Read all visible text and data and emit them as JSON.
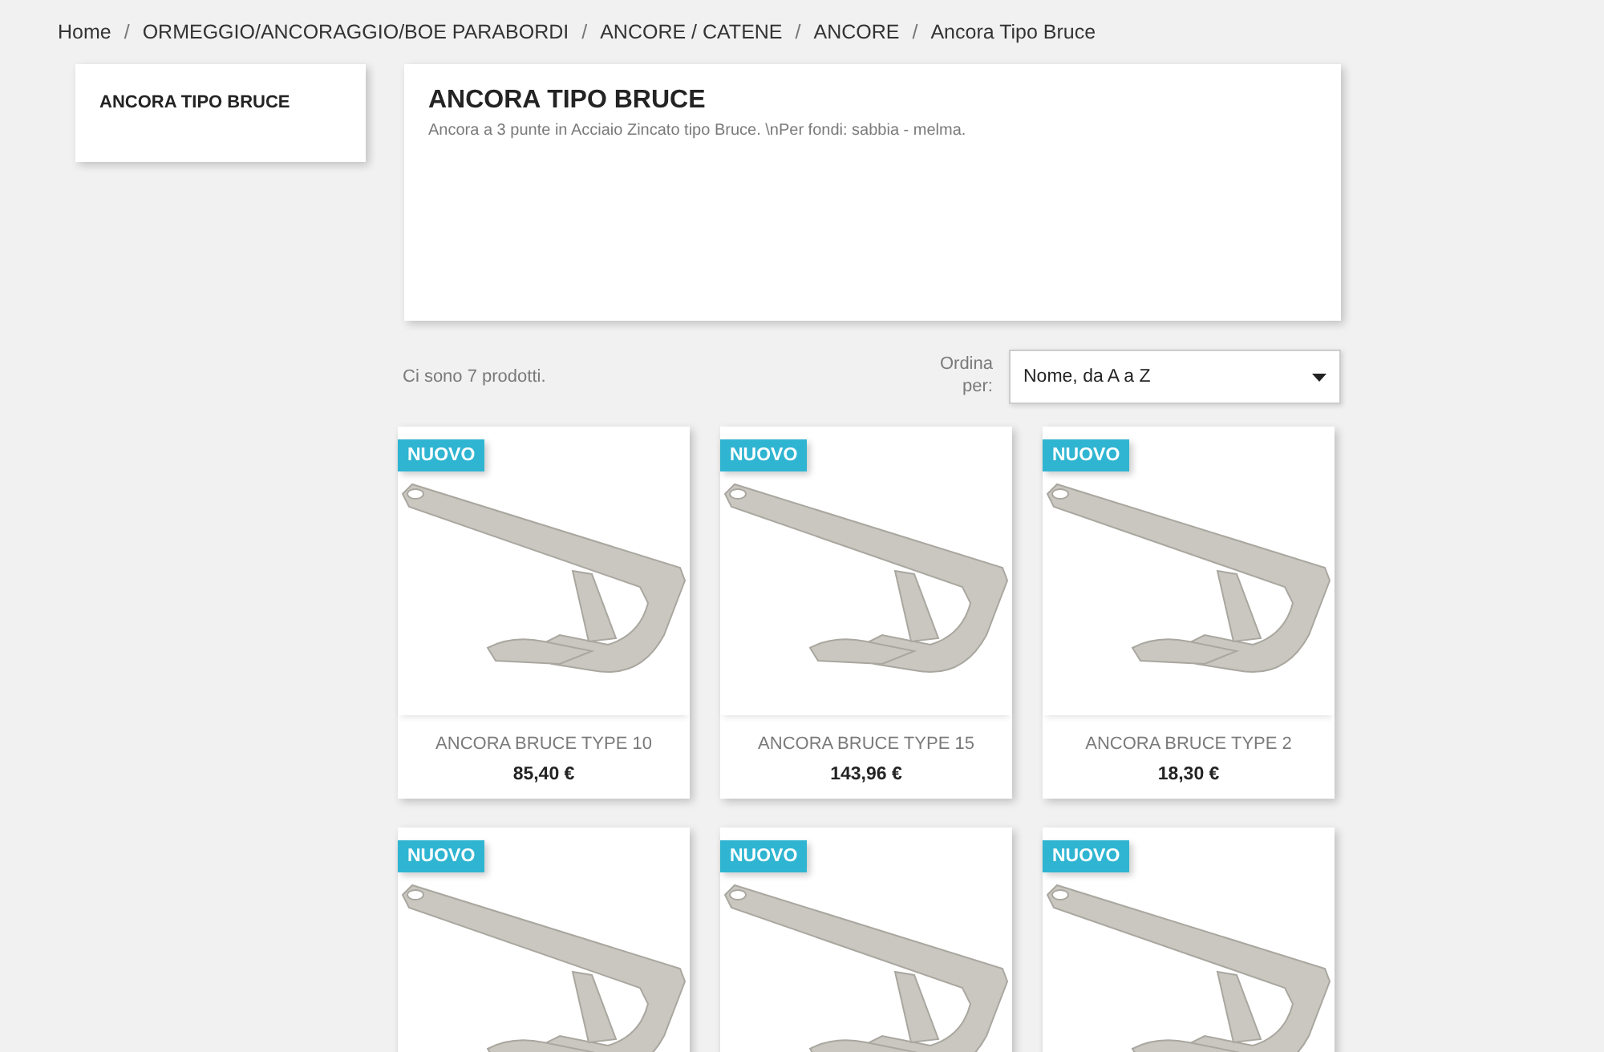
{
  "breadcrumb": {
    "separator": "/",
    "items": [
      "Home",
      "ORMEGGIO/ANCORAGGIO/BOE PARABORDI",
      "ANCORE / CATENE",
      "ANCORE",
      "Ancora Tipo Bruce"
    ]
  },
  "sidebar": {
    "title": "ANCORA TIPO BRUCE"
  },
  "category": {
    "title": "ANCORA TIPO BRUCE",
    "description": "Ancora a 3 punte in Acciaio Zincato tipo Bruce. \\nPer fondi: sabbia - melma."
  },
  "toolbar": {
    "count": "Ci sono 7 prodotti.",
    "sort_label": "Ordina per:",
    "sort_value": "Nome, da A a Z"
  },
  "products": [
    {
      "badge": "NUOVO",
      "name": "ANCORA BRUCE TYPE 10",
      "price": "85,40 €"
    },
    {
      "badge": "NUOVO",
      "name": "ANCORA BRUCE TYPE 15",
      "price": "143,96 €"
    },
    {
      "badge": "NUOVO",
      "name": "ANCORA BRUCE TYPE 2",
      "price": "18,30 €"
    },
    {
      "badge": "NUOVO"
    },
    {
      "badge": "NUOVO"
    },
    {
      "badge": "NUOVO"
    }
  ]
}
